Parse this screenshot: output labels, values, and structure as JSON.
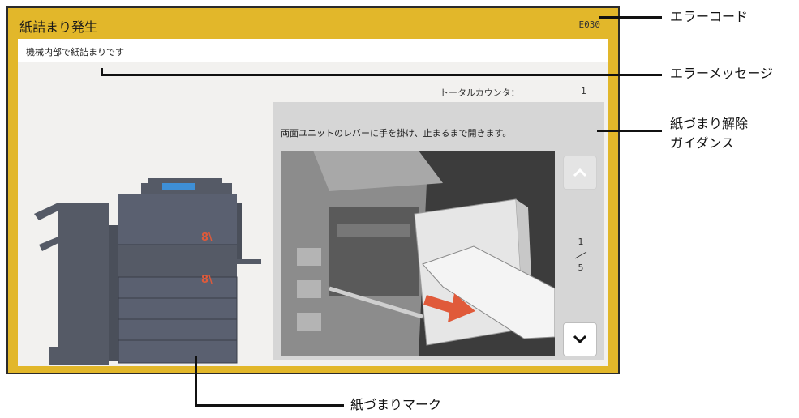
{
  "panel": {
    "title": "紙詰まり発生",
    "error_code": "E030",
    "message": "機械内部で紙詰まりです",
    "counter_label": "トータルカウンタ：",
    "counter_value": "1",
    "colors": {
      "frame": "#e2b72a",
      "jam_mark": "#e05a3a"
    }
  },
  "guidance": {
    "instruction": "両面ユニットのレバーに手を掛け、止まるまで開きます。",
    "page_current": "1",
    "page_total": "5",
    "up_icon": "chevron-up-icon",
    "down_icon": "chevron-down-icon"
  },
  "jam_marks": [
    "8\\",
    "8\\"
  ],
  "callouts": {
    "error_code": "エラーコード",
    "error_message": "エラーメッセージ",
    "guidance_line1": "紙づまり解除",
    "guidance_line2": "ガイダンス",
    "jam_mark": "紙づまりマーク"
  }
}
